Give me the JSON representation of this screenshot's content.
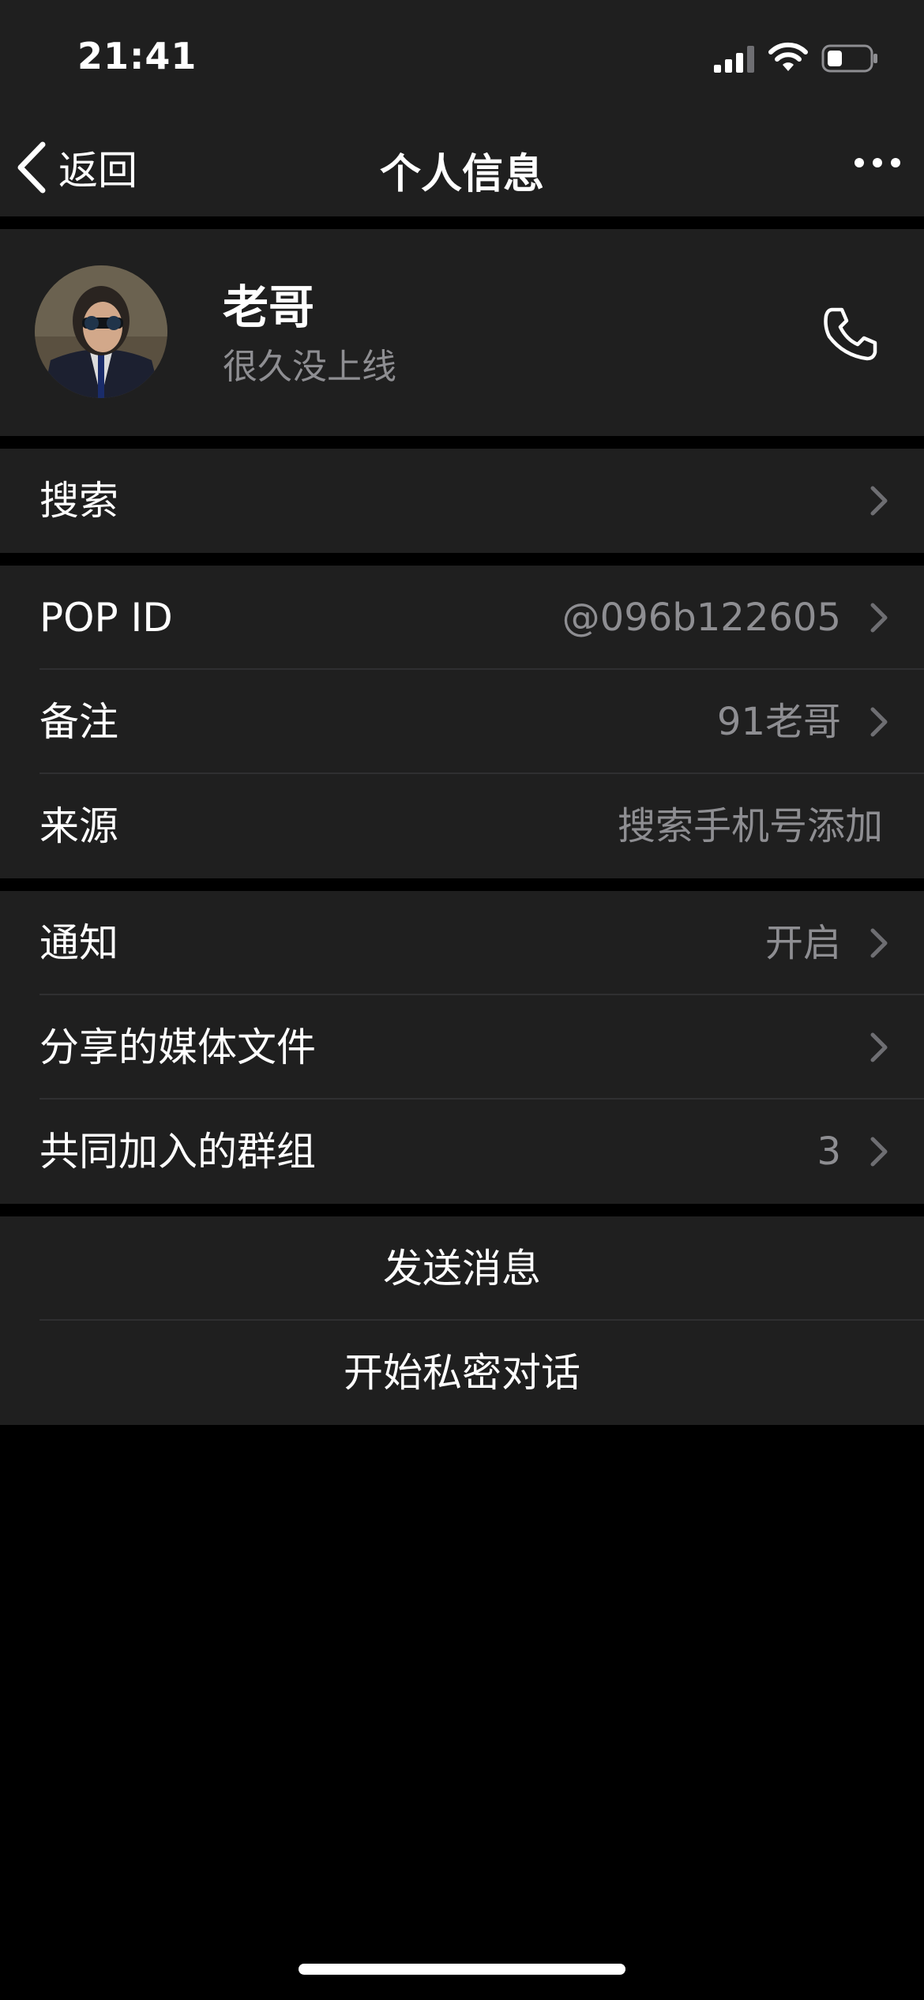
{
  "status_bar": {
    "time": "21:41"
  },
  "nav": {
    "back_label": "返回",
    "title": "个人信息"
  },
  "profile": {
    "name": "老哥",
    "status": "很久没上线"
  },
  "search": {
    "label": "搜索"
  },
  "info": [
    {
      "label": "POP ID",
      "value": "@096b122605"
    },
    {
      "label": "备注",
      "value": "91老哥"
    },
    {
      "label": "来源",
      "value": "搜索手机号添加"
    }
  ],
  "settings": [
    {
      "label": "通知",
      "value": "开启"
    },
    {
      "label": "分享的媒体文件",
      "value": ""
    },
    {
      "label": "共同加入的群组",
      "value": "3"
    }
  ],
  "actions": {
    "send_message": "发送消息",
    "secret_chat": "开始私密对话"
  }
}
